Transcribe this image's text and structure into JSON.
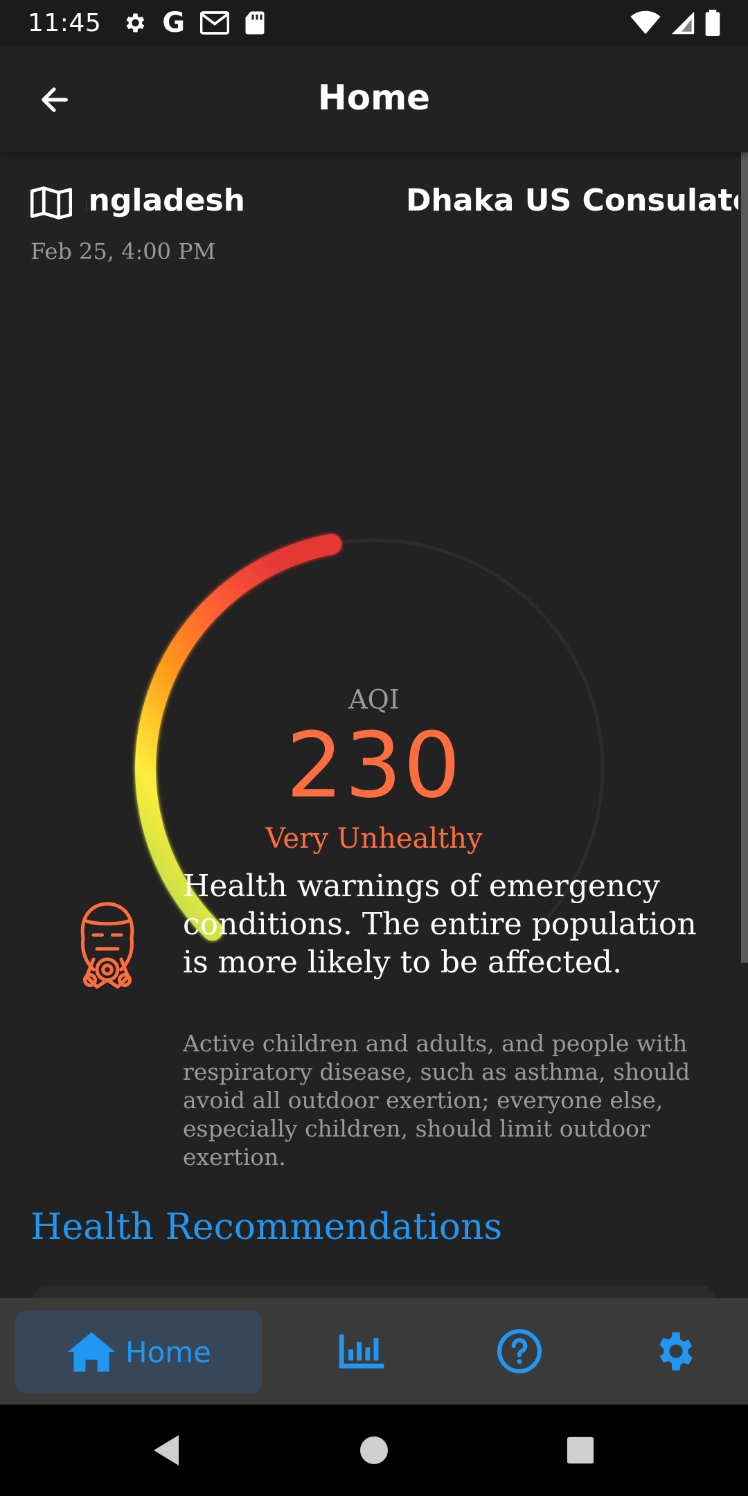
{
  "status_bar": {
    "time": "11:45",
    "left_icons": [
      "settings-icon",
      "google-icon",
      "gmail-icon",
      "sd-card-icon"
    ],
    "right_icons": [
      "wifi-icon",
      "cell-signal-icon",
      "battery-icon"
    ],
    "google_letter": "G"
  },
  "app_bar": {
    "title": "Home",
    "back_icon": "arrow-back-icon"
  },
  "location": {
    "country": "Bangladesh",
    "station": "Dhaka US Consulate",
    "timestamp": "Feb 25, 4:00 PM"
  },
  "aqi": {
    "label": "AQI",
    "value": "230",
    "value_number": 230,
    "status": "Very Unhealthy",
    "status_color": "#ff6e40",
    "gauge_fill_fraction": 0.46
  },
  "health": {
    "icon": "gas-mask-icon",
    "warning": "Health warnings of emergency conditions. The entire population is more likely to be affected.",
    "detail": "Active children and adults, and people with respiratory disease, such as asthma, should avoid all outdoor exertion; everyone else, especially children, should limit outdoor exertion."
  },
  "recommendations": {
    "heading": "Health Recommendations"
  },
  "bottom_nav": {
    "items": [
      {
        "label": "Home",
        "icon": "home-icon",
        "selected": true
      },
      {
        "label": "",
        "icon": "bar-chart-icon",
        "selected": false
      },
      {
        "label": "",
        "icon": "help-circle-icon",
        "selected": false
      },
      {
        "label": "",
        "icon": "settings-icon",
        "selected": false
      }
    ],
    "accent": "#2196f3",
    "selected_bg": "#37475a"
  },
  "system_nav": [
    "back-triangle-icon",
    "home-circle-icon",
    "recents-square-icon"
  ]
}
